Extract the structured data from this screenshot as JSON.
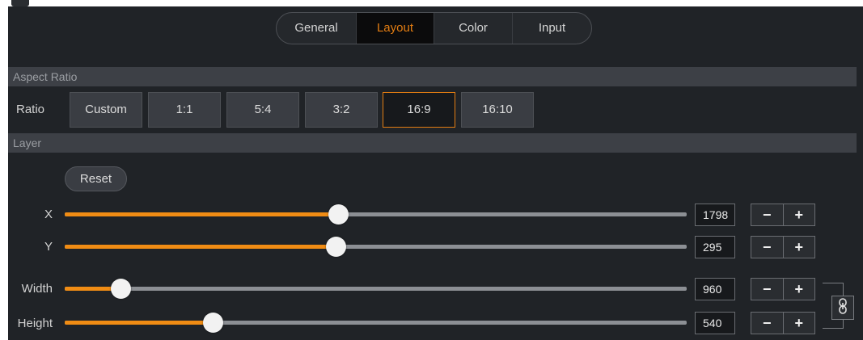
{
  "tabs": [
    {
      "label": "General",
      "active": false
    },
    {
      "label": "Layout",
      "active": true
    },
    {
      "label": "Color",
      "active": false
    },
    {
      "label": "Input",
      "active": false
    }
  ],
  "sections": {
    "aspect_ratio": "Aspect Ratio",
    "layer": "Layer"
  },
  "ratio": {
    "label": "Ratio",
    "options": [
      "Custom",
      "1:1",
      "5:4",
      "3:2",
      "16:9",
      "16:10"
    ],
    "selected": "16:9"
  },
  "layer": {
    "reset_label": "Reset",
    "x": {
      "label": "X",
      "value": "1798",
      "slider_fraction": 0.44
    },
    "y": {
      "label": "Y",
      "value": "295",
      "slider_fraction": 0.435
    },
    "width": {
      "label": "Width",
      "value": "960",
      "slider_fraction": 0.09
    },
    "height": {
      "label": "Height",
      "value": "540",
      "slider_fraction": 0.238
    }
  },
  "stepper": {
    "minus": "−",
    "plus": "+"
  },
  "colors": {
    "accent": "#f08c14",
    "background": "#202327",
    "section": "#3d4046"
  },
  "icons": {
    "aspect_lock": "link-icon"
  }
}
